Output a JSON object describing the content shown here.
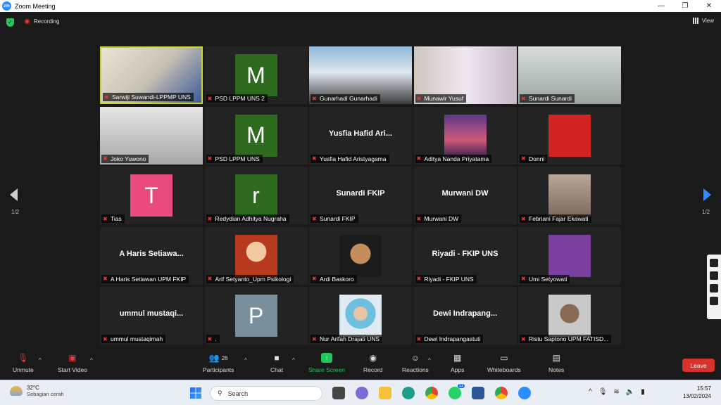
{
  "window": {
    "title": "Zoom Meeting",
    "app_icon": "zm"
  },
  "topbar": {
    "recording_label": "Recording",
    "view_label": "View"
  },
  "gallery": {
    "page_left": "1/2",
    "page_right": "1/2",
    "tiles": [
      {
        "name": "Sarwiji Suwandi-LPPMP UNS",
        "type": "video",
        "active": true
      },
      {
        "name": "PSD LPPM UNS 2",
        "type": "avatar",
        "letter": "M",
        "color": "#2f6b1f"
      },
      {
        "name": "Gunarhadi Gunarhadi",
        "type": "video"
      },
      {
        "name": "Munawir Yusuf",
        "type": "video"
      },
      {
        "name": "Sunardi Sunardi",
        "type": "video"
      },
      {
        "name": "Joko Yuwono",
        "type": "video"
      },
      {
        "name": "PSD LPPM UNS",
        "type": "avatar",
        "letter": "M",
        "color": "#2f6b1f"
      },
      {
        "name": "Yusfia Hafid Aristyagama",
        "type": "text",
        "display": "Yusfia Hafid Ari..."
      },
      {
        "name": "Aditya Nanda Priyatama",
        "type": "photo",
        "photo": "sunset"
      },
      {
        "name": "Donni",
        "type": "photo",
        "photo": "portrait-red"
      },
      {
        "name": "Tias",
        "type": "avatar",
        "letter": "T",
        "color": "#e94b7d"
      },
      {
        "name": "Redydian Adhitya Nugraha",
        "type": "avatar",
        "letter": "r",
        "color": "#2f6b1f"
      },
      {
        "name": "Sunardi FKIP",
        "type": "text",
        "display": "Sunardi FKIP"
      },
      {
        "name": "Murwani DW",
        "type": "text",
        "display": "Murwani DW"
      },
      {
        "name": "Febriani Fajar Ekawati",
        "type": "photo",
        "photo": "building-portrait"
      },
      {
        "name": "A Haris Setiawan UPM FKIP",
        "type": "text",
        "display": "A Haris Setiawa..."
      },
      {
        "name": "Arif Setyanto_Upm Psikologi",
        "type": "photo",
        "photo": "portrait-stage"
      },
      {
        "name": "Ardi Baskoro",
        "type": "photo",
        "photo": "puppet"
      },
      {
        "name": "Riyadi - FKIP UNS",
        "type": "text",
        "display": "Riyadi - FKIP UNS"
      },
      {
        "name": "Umi Setyowati",
        "type": "photo",
        "photo": "logo-purple"
      },
      {
        "name": "ummul mustaqimah",
        "type": "text",
        "display": "ummul mustaqi..."
      },
      {
        "name": ".",
        "type": "avatar",
        "letter": "P",
        "color": "#7a8f9c"
      },
      {
        "name": "Nur Arifah Drajati UNS",
        "type": "photo",
        "photo": "portrait-hijab"
      },
      {
        "name": "Dewi Indrapangastuti",
        "type": "text",
        "display": "Dewi Indrapang..."
      },
      {
        "name": "Ristu Saptono UPM FATISD...",
        "type": "photo",
        "photo": "portrait-man"
      }
    ]
  },
  "toolbar": {
    "unmute": "Unmute",
    "start_video": "Start Video",
    "participants": "Participants",
    "participants_count": "26",
    "chat": "Chat",
    "share_screen": "Share Screen",
    "record": "Record",
    "reactions": "Reactions",
    "apps": "Apps",
    "whiteboards": "Whiteboards",
    "notes": "Notes",
    "leave": "Leave"
  },
  "taskbar": {
    "temperature": "32°C",
    "weather": "Sebagian cerah",
    "search_placeholder": "Search",
    "whatsapp_badge": "11",
    "time": "15:57",
    "date": "13/02/2024"
  }
}
